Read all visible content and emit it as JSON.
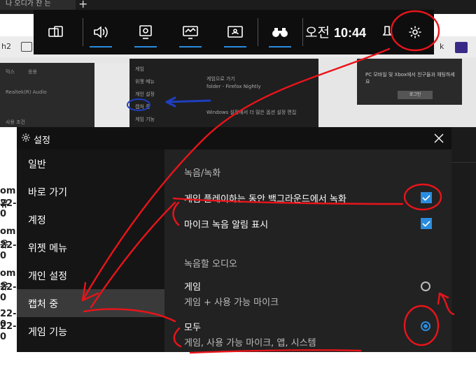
{
  "background": {
    "browser_tab_text": "나 오디가 찬 는",
    "addr_left_text": "h2",
    "addr_right_text": "k",
    "left_panel": [
      "믹스",
      "응용",
      "Realtek(R) Audio",
      "사용 조건"
    ],
    "mid_panel": [
      "게임",
      "위젯 메뉴",
      "개인 설정",
      "캡처 중",
      "게임 기능",
      "게임으로 가기",
      "folder - Firefox Nightly",
      "Windows 설정에서 더 많은 옵션 설정 편집"
    ],
    "right_panel": [
      "PC 모바일 및 Xbox에서 친구들과 채팅하세요",
      "로그인"
    ],
    "page_list": [
      "om 유",
      "22-0",
      "om 유",
      "22-0",
      "om 유",
      "22-0",
      "22-0",
      "22-0"
    ]
  },
  "gamebar": {
    "period": "오전",
    "time": "10:44",
    "buttons": [
      {
        "name": "widget-menu-icon"
      },
      {
        "name": "audio-icon"
      },
      {
        "name": "capture-icon"
      },
      {
        "name": "performance-icon"
      },
      {
        "name": "xbox-social-icon"
      }
    ],
    "accent": "#2a8cde"
  },
  "settings": {
    "title": "설정",
    "nav": [
      {
        "label": "일반"
      },
      {
        "label": "바로 가기"
      },
      {
        "label": "계정"
      },
      {
        "label": "위젯 메뉴"
      },
      {
        "label": "개인 설정"
      },
      {
        "label": "캡처 중"
      },
      {
        "label": "게임 기능"
      }
    ],
    "active_nav": "캡처 중",
    "section_recording": "녹음/녹화",
    "option_bg_record": "게임 플레이하는 동안 백그라운드에서 녹화",
    "option_bg_record_checked": true,
    "option_mic_notify": "마이크 녹음 알림 표시",
    "option_mic_notify_checked": true,
    "section_audio": "녹음할 오디오",
    "audio_game": "게임",
    "audio_game_desc": "게임 + 사용 가능 마이크",
    "audio_all": "모두",
    "audio_all_desc": "게임, 사용 가능 마이크, 앱, 시스템",
    "selected_audio": "모두"
  }
}
